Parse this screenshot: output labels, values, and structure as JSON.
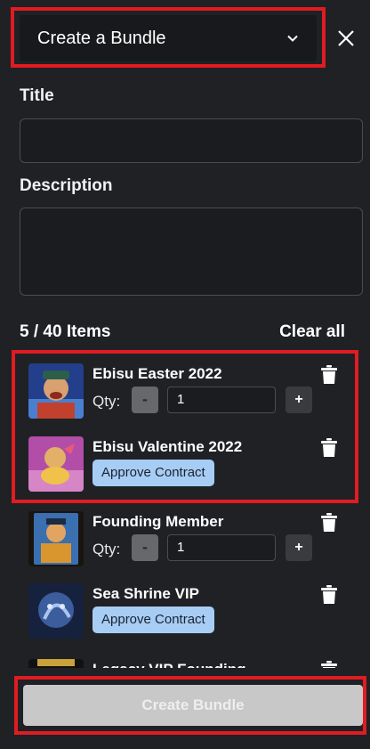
{
  "header": {
    "mode_label": "Create a Bundle"
  },
  "form": {
    "title_label": "Title",
    "title_value": "",
    "description_label": "Description",
    "description_value": ""
  },
  "items_header": {
    "count": "5 / 40 Items",
    "clear_all": "Clear all"
  },
  "items": [
    {
      "name": "Ebisu Easter 2022",
      "qty_label": "Qty:",
      "minus": "-",
      "qty": "1",
      "plus": "+"
    },
    {
      "name": "Ebisu Valentine 2022",
      "approve": "Approve Contract"
    },
    {
      "name": "Founding Member",
      "qty_label": "Qty:",
      "minus": "-",
      "qty": "1",
      "plus": "+"
    },
    {
      "name": "Sea Shrine VIP",
      "approve": "Approve Contract"
    },
    {
      "name": "Legacy VIP Founding"
    }
  ],
  "footer": {
    "create_label": "Create Bundle"
  },
  "colors": {
    "background": "#1f2125",
    "highlight": "#e01c22",
    "approve_button": "#a7cdf5",
    "create_button_disabled": "#c8c8c8"
  },
  "icons": [
    "chevron-down-icon",
    "close-icon",
    "trash-icon"
  ]
}
